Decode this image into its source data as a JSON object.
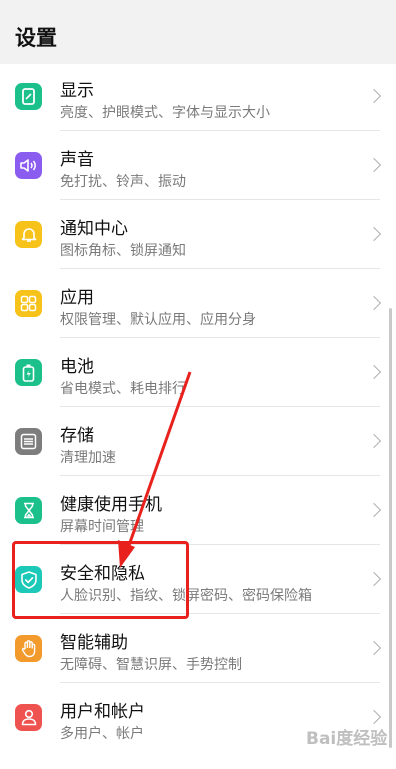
{
  "header": {
    "title": "设置"
  },
  "items": [
    {
      "label": "显示",
      "sub": "亮度、护眼模式、字体与显示大小",
      "icon": "display-icon",
      "color": "#1cc08a"
    },
    {
      "label": "声音",
      "sub": "免打扰、铃声、振动",
      "icon": "speaker-icon",
      "color": "#8b5cf0"
    },
    {
      "label": "通知中心",
      "sub": "图标角标、锁屏通知",
      "icon": "bell-icon",
      "color": "#f7c21a"
    },
    {
      "label": "应用",
      "sub": "权限管理、默认应用、应用分身",
      "icon": "apps-grid-icon",
      "color": "#f7c21a"
    },
    {
      "label": "电池",
      "sub": "省电模式、耗电排行",
      "icon": "battery-icon",
      "color": "#1cc08a"
    },
    {
      "label": "存储",
      "sub": "清理加速",
      "icon": "storage-icon",
      "color": "#7d7d7d"
    },
    {
      "label": "健康使用手机",
      "sub": "屏幕时间管理",
      "icon": "hourglass-icon",
      "color": "#1cc08a"
    },
    {
      "label": "安全和隐私",
      "sub": "人脸识别、指纹、锁屏密码、密码保险箱",
      "icon": "shield-icon",
      "color": "#1cc8b8"
    },
    {
      "label": "智能辅助",
      "sub": "无障碍、智慧识屏、手势控制",
      "icon": "hand-icon",
      "color": "#f39a2c"
    },
    {
      "label": "用户和帐户",
      "sub": "多用户、帐户",
      "icon": "user-icon",
      "color": "#ef5350"
    }
  ],
  "watermark": "Bai度经验",
  "annotation_color": "#e8211d"
}
